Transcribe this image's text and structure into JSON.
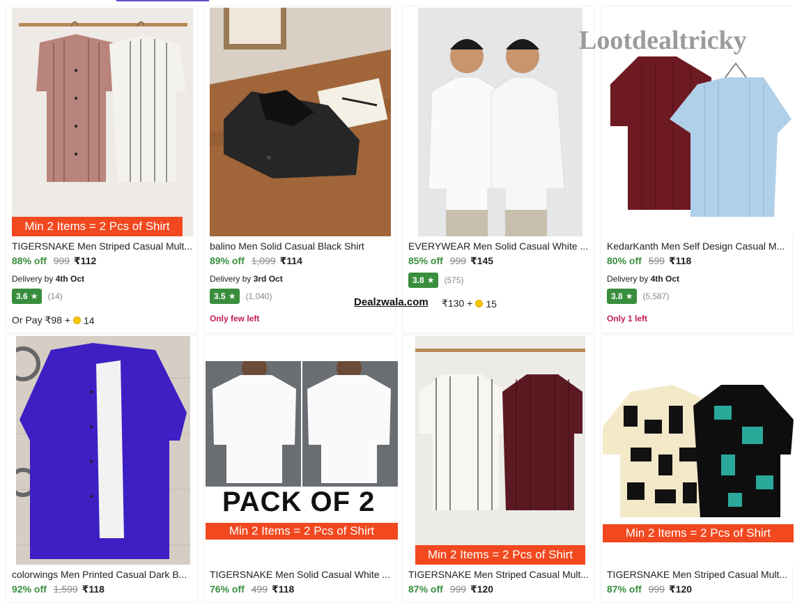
{
  "watermark": "Lootdealtricky",
  "overlay_text": "Dealzwala.com",
  "banner_text": "Min 2 Items = 2 Pcs of Shirt",
  "pack_text": "PACK OF 2",
  "delivery_prefix": "Delivery by",
  "products": [
    {
      "title": "TIGERSNAKE Men Striped Casual Mult...",
      "off": "88% off",
      "mrp": "999",
      "price": "₹112",
      "delivery": "4th Oct",
      "rating": "3.6",
      "reviews": "(14)",
      "orpay": "Or Pay ₹98 +",
      "coins": "14"
    },
    {
      "title": "balino Men Solid Casual Black Shirt",
      "off": "89% off",
      "mrp": "1,099",
      "price": "₹114",
      "delivery": "3rd Oct",
      "rating": "3.5",
      "reviews": "(1,040)",
      "stock": "Only few left"
    },
    {
      "title": "EVERYWEAR Men Solid Casual White ...",
      "off": "85% off",
      "mrp": "999",
      "price": "₹145",
      "rating": "3.8",
      "reviews": "(575)",
      "orpay": "₹130 +",
      "coins": "15"
    },
    {
      "title": "KedarKanth Men Self Design Casual M...",
      "off": "80% off",
      "mrp": "599",
      "price": "₹118",
      "delivery": "4th Oct",
      "rating": "3.8",
      "reviews": "(5,587)",
      "stock": "Only 1 left"
    },
    {
      "title": "colorwings Men Printed Casual Dark B...",
      "off": "92% off",
      "mrp": "1,599",
      "price": "₹118"
    },
    {
      "title": "TIGERSNAKE Men Solid Casual White ...",
      "off": "76% off",
      "mrp": "499",
      "price": "₹118"
    },
    {
      "title": "TIGERSNAKE Men Striped Casual Mult...",
      "off": "87% off",
      "mrp": "999",
      "price": "₹120"
    },
    {
      "title": "TIGERSNAKE Men Striped Casual Mult...",
      "off": "87% off",
      "mrp": "999",
      "price": "₹120"
    }
  ],
  "colors": {
    "discount": "#388e3c",
    "rating_badge": "#388e3c",
    "banner": "#f2481f",
    "stock": "#c2185b"
  }
}
